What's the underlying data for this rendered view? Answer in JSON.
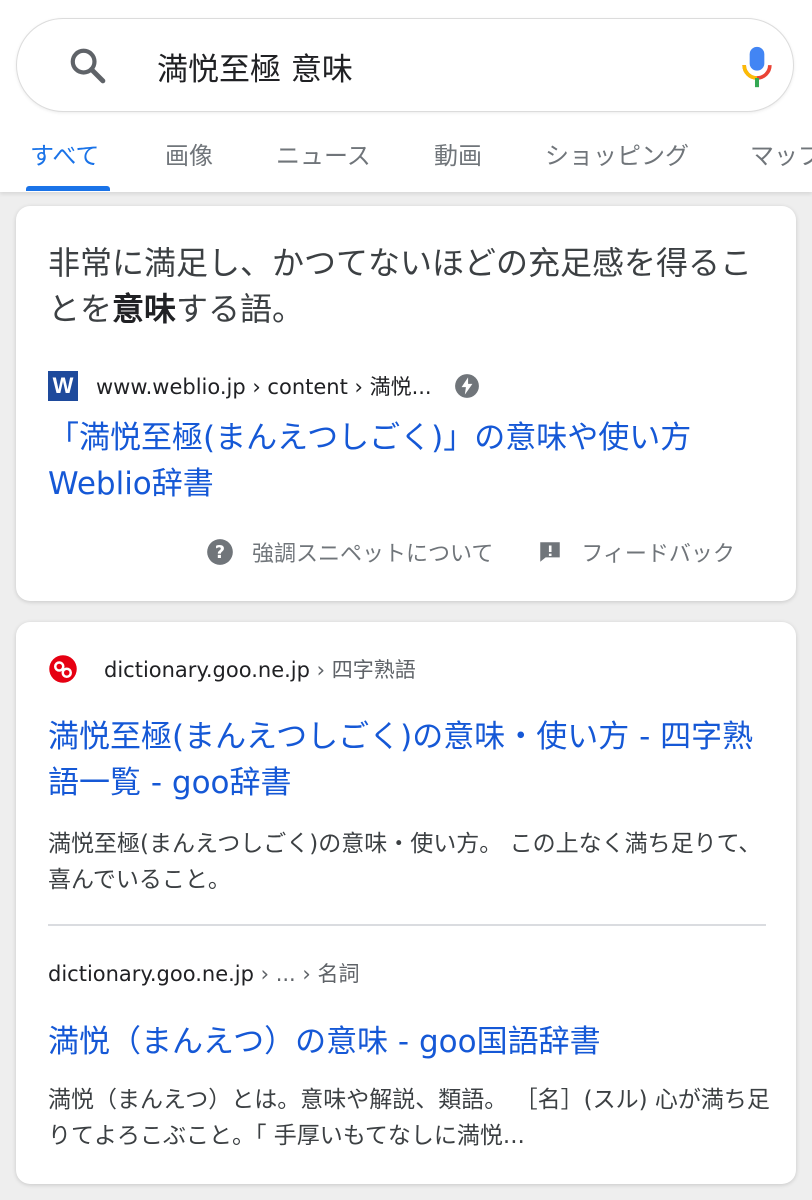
{
  "search": {
    "query": "満悦至極 意味"
  },
  "tabs": [
    "すべて",
    "画像",
    "ニュース",
    "動画",
    "ショッピング",
    "マップ"
  ],
  "featured_snippet": {
    "answer_prefix": "非常に満足し、かつてないほどの充足感を得ることを",
    "answer_bold": "意味",
    "answer_suffix": "する語。",
    "favicon_letter": "W",
    "source_domain": "www.weblio.jp",
    "source_path": " › content › 満悦...",
    "title": "「満悦至極(まんえつしごく)」の意味や使い方 Weblio辞書",
    "about_label": "強調スニペットについて",
    "feedback_label": "フィードバック"
  },
  "results": [
    {
      "domain": "dictionary.goo.ne.jp",
      "path": " › 四字熟語",
      "title": "満悦至極(まんえつしごく)の意味・使い方 - 四字熟語一覧 - goo辞書",
      "description": "満悦至極(まんえつしごく)の意味・使い方。 この上なく満ち足りて、喜んでいること。"
    },
    {
      "domain": "dictionary.goo.ne.jp",
      "path": " › ... › 名詞",
      "title": "満悦（まんえつ）の意味 - goo国語辞書",
      "description": "満悦（まんえつ）とは。意味や解説、類語。 ［名］(スル) 心が満ち足りてよろこぶこと。「 手厚いもてなしに満悦..."
    }
  ],
  "colors": {
    "accent": "#1a73e8",
    "link": "#1558d6",
    "secondary_text": "#70757a",
    "weblio_brand": "#1e4a9c",
    "goo_brand": "#e60012"
  }
}
